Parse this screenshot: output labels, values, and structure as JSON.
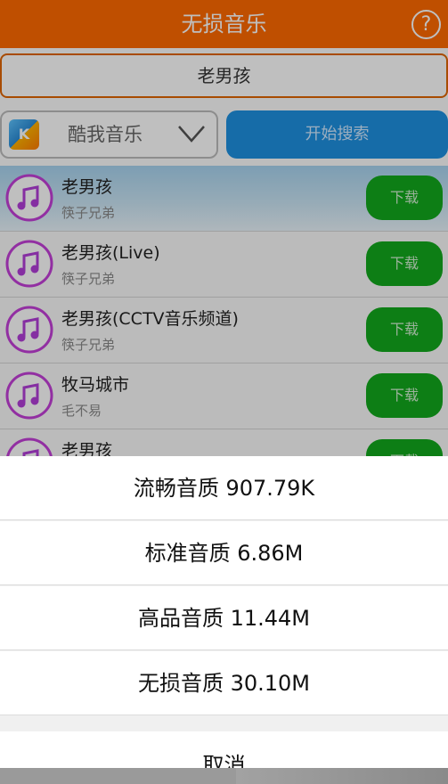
{
  "app": {
    "title": "无损音乐",
    "help_label": "?"
  },
  "search": {
    "query": "老男孩",
    "source": "酷我音乐",
    "source_logo": "K",
    "search_button": "开始搜索"
  },
  "results": [
    {
      "title": "老男孩",
      "artist": "筷子兄弟",
      "download": "下载"
    },
    {
      "title": "老男孩(Live)",
      "artist": "筷子兄弟",
      "download": "下载"
    },
    {
      "title": "老男孩(CCTV音乐频道)",
      "artist": "筷子兄弟",
      "download": "下载"
    },
    {
      "title": "牧马城市",
      "artist": "毛不易",
      "download": "下载"
    },
    {
      "title": "老男孩",
      "artist": "",
      "download": "下载"
    }
  ],
  "quality_sheet": {
    "options": [
      "流畅音质 907.79K",
      "标准音质 6.86M",
      "高品音质 11.44M",
      "无损音质 30.10M"
    ],
    "cancel": "取消"
  },
  "colors": {
    "header": "#ff6a00",
    "download": "#12a81c",
    "search_button": "#1e90e0"
  }
}
